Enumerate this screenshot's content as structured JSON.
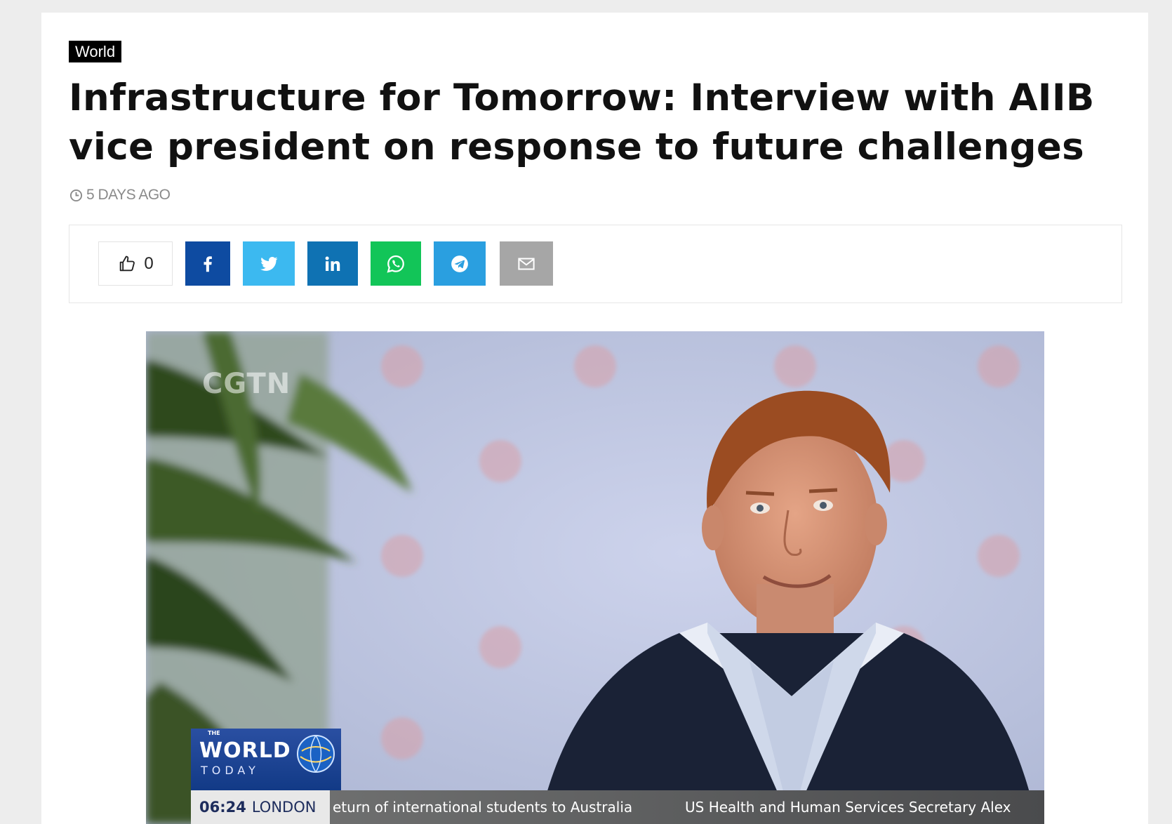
{
  "article": {
    "category": "World",
    "title": "Infrastructure for Tomorrow: Interview with AIIB vice president on response to future challenges",
    "posted": "5 DAYS AGO"
  },
  "share": {
    "like_count": "0",
    "buttons": [
      {
        "network": "facebook",
        "icon": "facebook-icon",
        "color": "#0e4ba1"
      },
      {
        "network": "twitter",
        "icon": "twitter-icon",
        "color": "#3cb9f0"
      },
      {
        "network": "linkedin",
        "icon": "linkedin-icon",
        "color": "#0f72b3"
      },
      {
        "network": "whatsapp",
        "icon": "whatsapp-icon",
        "color": "#12c558"
      },
      {
        "network": "telegram",
        "icon": "telegram-icon",
        "color": "#2a9fe0"
      },
      {
        "network": "email",
        "icon": "mail-icon",
        "color": "#a6a6a6"
      }
    ]
  },
  "video": {
    "watermark": "CGTN",
    "show_logo": {
      "the": "THE",
      "world": "WORLD",
      "today": "TODAY"
    },
    "clock_time": "06:24",
    "clock_city": "LONDON",
    "ticker_1": "eturn of international students to Australia",
    "ticker_2": "US Health and Human Services Secretary Alex"
  }
}
